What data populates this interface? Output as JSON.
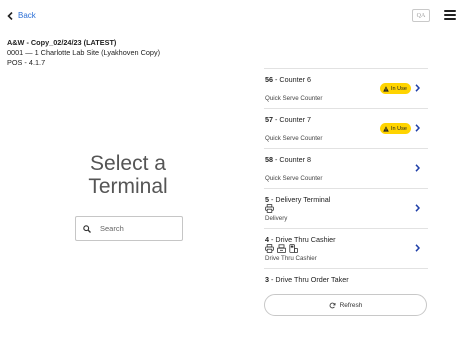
{
  "header": {
    "back_label": "Back",
    "qa_label": "QA"
  },
  "site": {
    "name": "A&W - Copy_02/24/23 (LATEST)",
    "location": "0001 — 1 Charlotte Lab Site (Lyakhoven Copy)",
    "pos_version": "POS - 4.1.7"
  },
  "hero": {
    "line1": "Select a",
    "line2": "Terminal"
  },
  "search": {
    "placeholder": "Search",
    "value": ""
  },
  "terminals": [
    {
      "number": "56",
      "name": "Counter 6",
      "subtitle": "Quick Serve Counter",
      "status": "In Use",
      "icons": []
    },
    {
      "number": "57",
      "name": "Counter 7",
      "subtitle": "Quick Serve Counter",
      "status": "In Use",
      "icons": []
    },
    {
      "number": "58",
      "name": "Counter 8",
      "subtitle": "Quick Serve Counter",
      "status": "",
      "icons": []
    },
    {
      "number": "5",
      "name": "Delivery Terminal",
      "subtitle": "Delivery",
      "status": "",
      "icons": [
        "printer-icon"
      ]
    },
    {
      "number": "4",
      "name": "Drive Thru Cashier",
      "subtitle": "Drive Thru Cashier",
      "status": "",
      "icons": [
        "printer-icon",
        "cash-drawer-icon",
        "card-reader-icon"
      ]
    },
    {
      "number": "3",
      "name": "Drive Thru Order Taker",
      "subtitle": "",
      "status": "",
      "icons": []
    }
  ],
  "refresh_label": "Refresh",
  "colors": {
    "accent": "#2b6fd6",
    "in_use_badge": "#ffd400",
    "chevron": "#1f3fa8"
  }
}
